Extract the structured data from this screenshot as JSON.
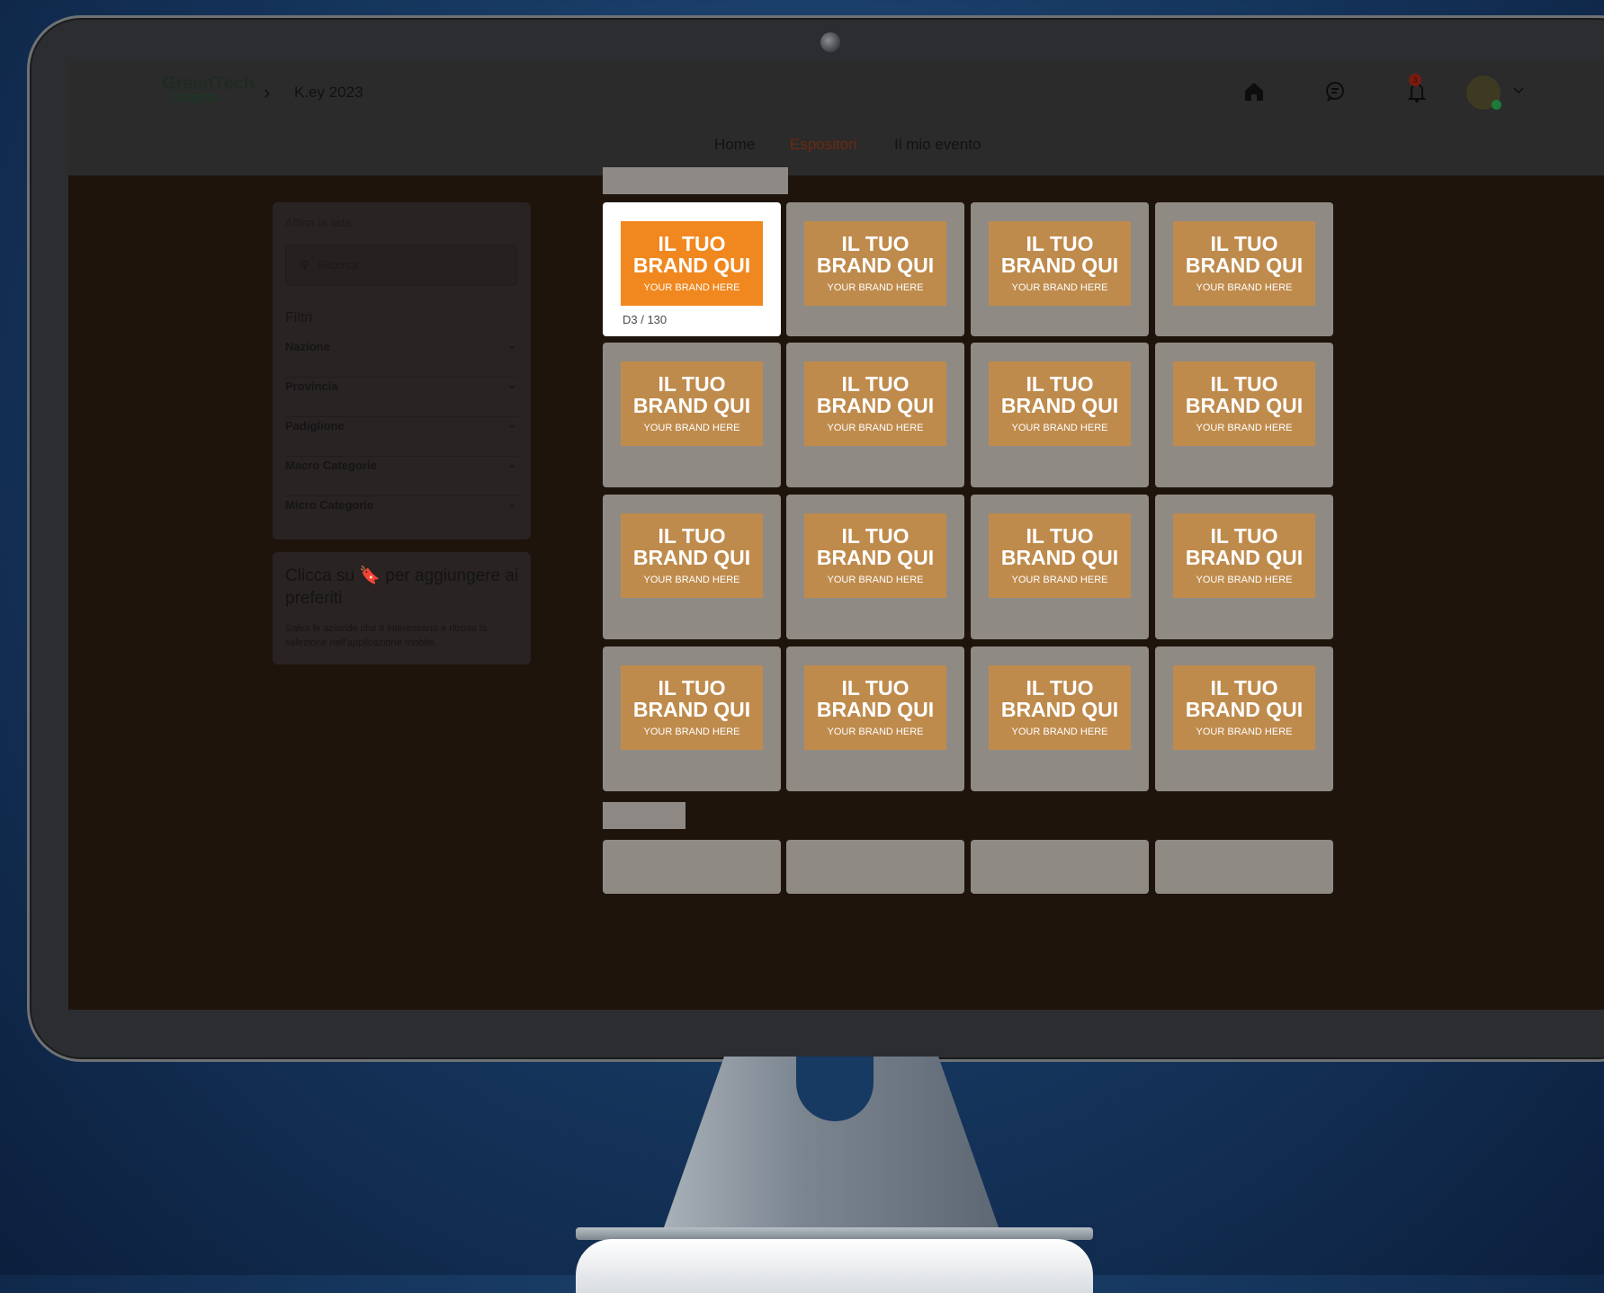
{
  "app": {
    "logo_main": "GreenTech",
    "logo_sub": "Insights",
    "breadcrumb_event": "K.ey 2023",
    "notification_count": "3"
  },
  "nav": {
    "home": "Home",
    "exhibitors": "Espositori",
    "my_event": "Il mio evento"
  },
  "sidebar": {
    "refine_label": "Affina la lista",
    "search_placeholder": "Ricerca",
    "filters_title": "Filtri",
    "filters": [
      "Nazione",
      "Provincia",
      "Padiglione",
      "Macro Categorie",
      "Micro Categorie"
    ],
    "favorites_title": "Clicca su 🔖 per aggiungere ai preferiti",
    "favorites_desc": "Salva le aziende che ti interessano e ritrova la selezione nell'applicazione mobile."
  },
  "brand_card": {
    "line1": "IL TUO",
    "line2": "BRAND QUI",
    "line3": "YOUR BRAND HERE"
  },
  "active_stand_code": "D3 / 130",
  "icons": [
    "home-icon",
    "chat-icon",
    "bell-icon",
    "search-icon",
    "chevron-down-icon"
  ],
  "colors": {
    "brand_orange": "#f0881f",
    "dimmed_orange": "#bf8b4c",
    "active_nav": "#6a2a10"
  }
}
